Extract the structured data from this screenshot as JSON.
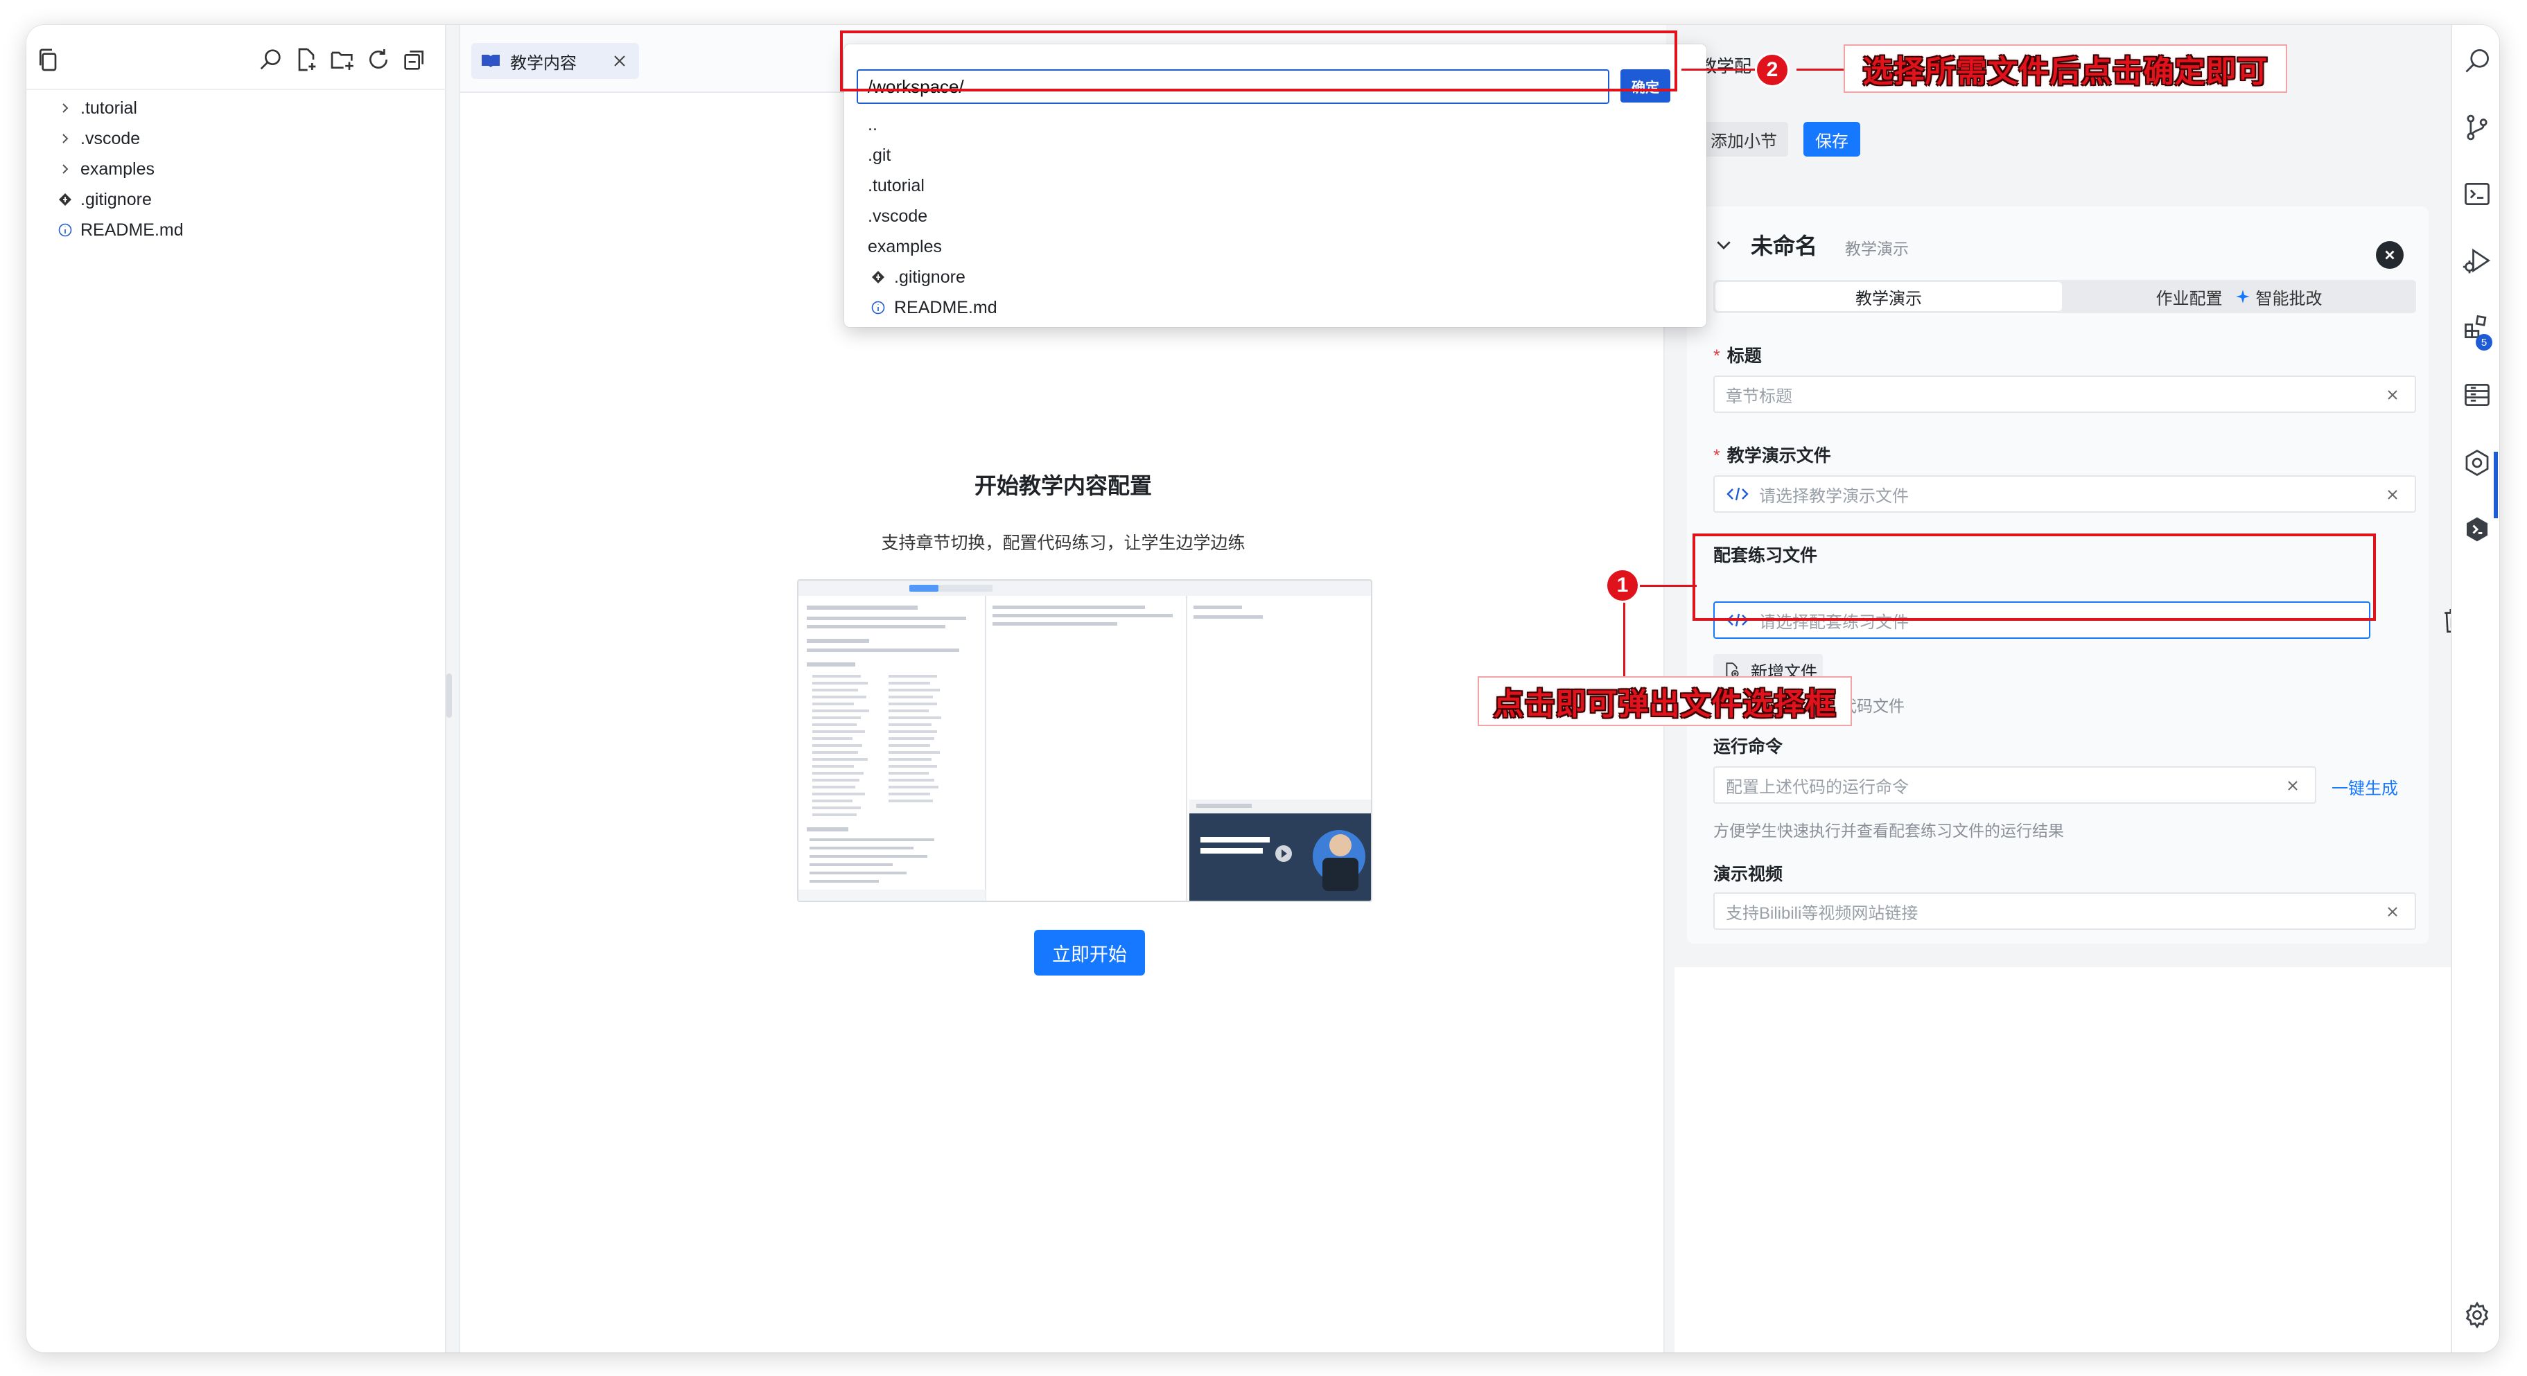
{
  "explorer": {
    "tree": [
      {
        "label": ".tutorial",
        "kind": "folder"
      },
      {
        "label": ".vscode",
        "kind": "folder"
      },
      {
        "label": "examples",
        "kind": "folder"
      },
      {
        "label": ".gitignore",
        "kind": "git"
      },
      {
        "label": "README.md",
        "kind": "info"
      }
    ]
  },
  "editor": {
    "tab_label": "教学内容",
    "welcome_title": "开始教学内容配置",
    "welcome_subtitle": "支持章节切换，配置代码练习，让学生边学边练",
    "start_button": "立即开始"
  },
  "picker": {
    "path_value": "/workspace/",
    "confirm_label": "确定",
    "items": [
      {
        "label": "..",
        "kind": "plain"
      },
      {
        "label": ".git",
        "kind": "plain"
      },
      {
        "label": ".tutorial",
        "kind": "plain"
      },
      {
        "label": ".vscode",
        "kind": "plain"
      },
      {
        "label": "examples",
        "kind": "plain"
      },
      {
        "label": ".gitignore",
        "kind": "git"
      },
      {
        "label": "README.md",
        "kind": "info"
      }
    ]
  },
  "config": {
    "title": "教学配",
    "add_section_label": "添加小节",
    "save_label": "保存",
    "section": {
      "name": "未命名",
      "name_sub": "教学演示",
      "tab_demo": "教学演示",
      "tab_homework": "作业配置",
      "tab_grading": "智能批改",
      "title_label": "标题",
      "title_placeholder": "章节标题",
      "demo_file_label": "教学演示文件",
      "demo_file_placeholder": "请选择教学演示文件",
      "exercise_file_label": "配套练习文件",
      "exercise_file_placeholder": "请选择配套练习文件",
      "new_file_label": "新增文件",
      "exercise_hint": "请选择配套的练习代码文件",
      "run_cmd_label": "运行命令",
      "run_cmd_placeholder": "配置上述代码的运行命令",
      "run_cmd_generate": "一键生成",
      "run_cmd_hint": "方便学生快速执行并查看配套练习文件的运行结果",
      "video_label": "演示视频",
      "video_placeholder": "支持Bilibili等视频网站链接"
    }
  },
  "activity": {
    "extensions_badge": "5"
  },
  "annotations": {
    "step1_number": "1",
    "step1_text": "点击即可弹出文件选择框",
    "step2_number": "2",
    "step2_text": "选择所需文件后点击确定即可",
    "color": "#e0121b"
  }
}
